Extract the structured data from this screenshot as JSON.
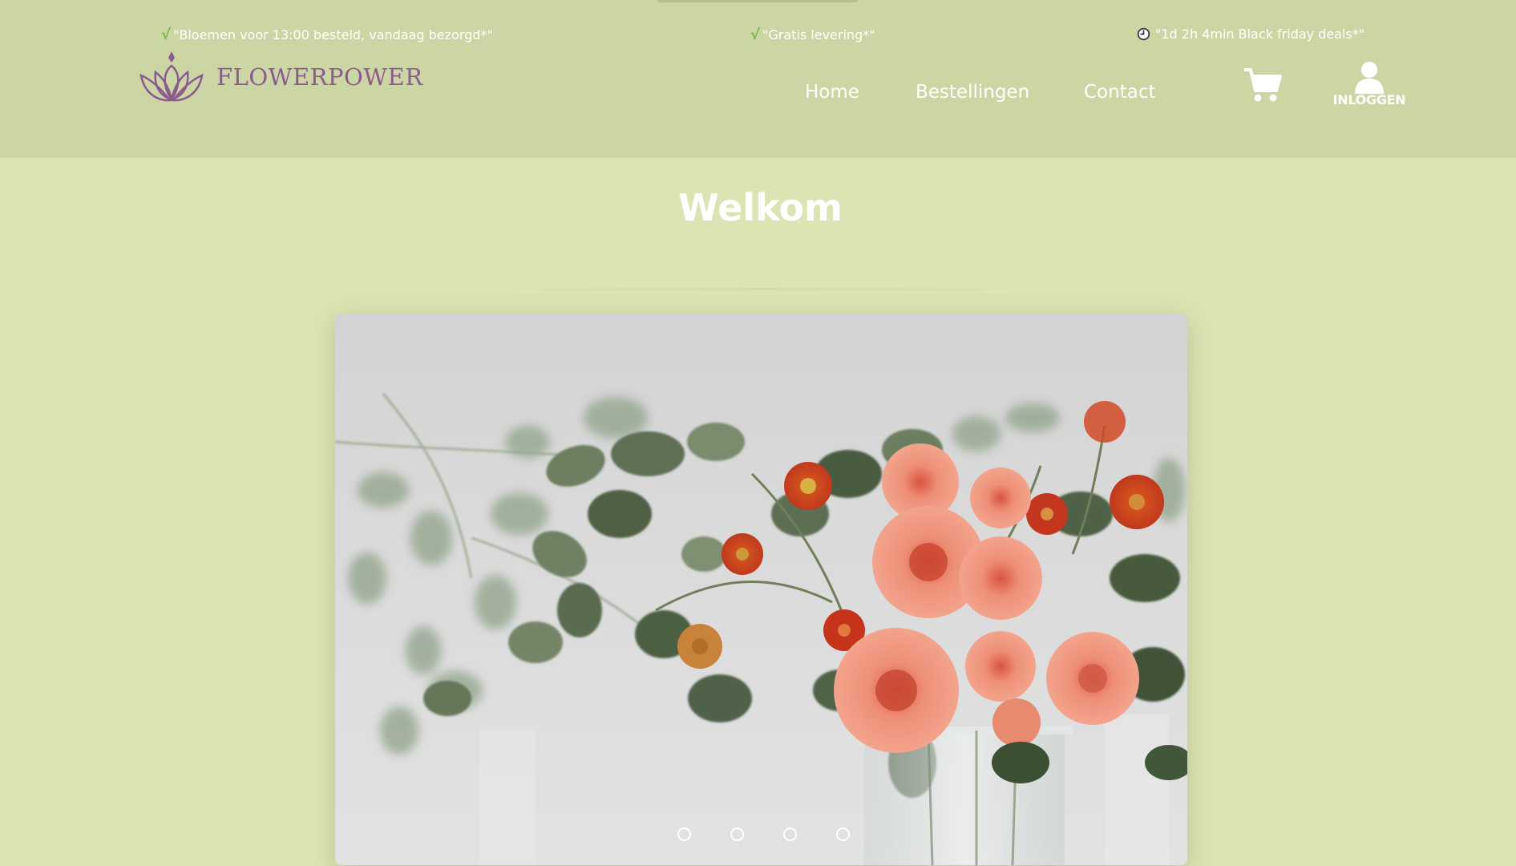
{
  "header": {
    "usps": [
      {
        "icon": "check-icon",
        "text": "\"Bloemen voor 13:00 besteld, vandaag bezorgd*\""
      },
      {
        "icon": "check-icon",
        "text": "\"Gratis levering*\""
      },
      {
        "icon": "clock-icon",
        "text": "\"1d 2h 4min Black friday deals*\""
      }
    ],
    "logo_text": "FLOWERPOWER",
    "nav": [
      "Home",
      "Bestellingen",
      "Contact"
    ],
    "cart_icon": "shopping-cart-icon",
    "login_icon": "user-icon",
    "login_label": "INLOGGEN"
  },
  "main": {
    "title": "Welkom",
    "carousel": {
      "slides": 4,
      "image": "bouquet of peach roses, orange strawflowers and eucalyptus in a glass vase"
    }
  },
  "colors": {
    "header_bg": "#ccd6a4",
    "page_bg": "#dce4b4",
    "logo": "#8b5a8e",
    "check": "#7ab648",
    "text": "#ffffff"
  }
}
